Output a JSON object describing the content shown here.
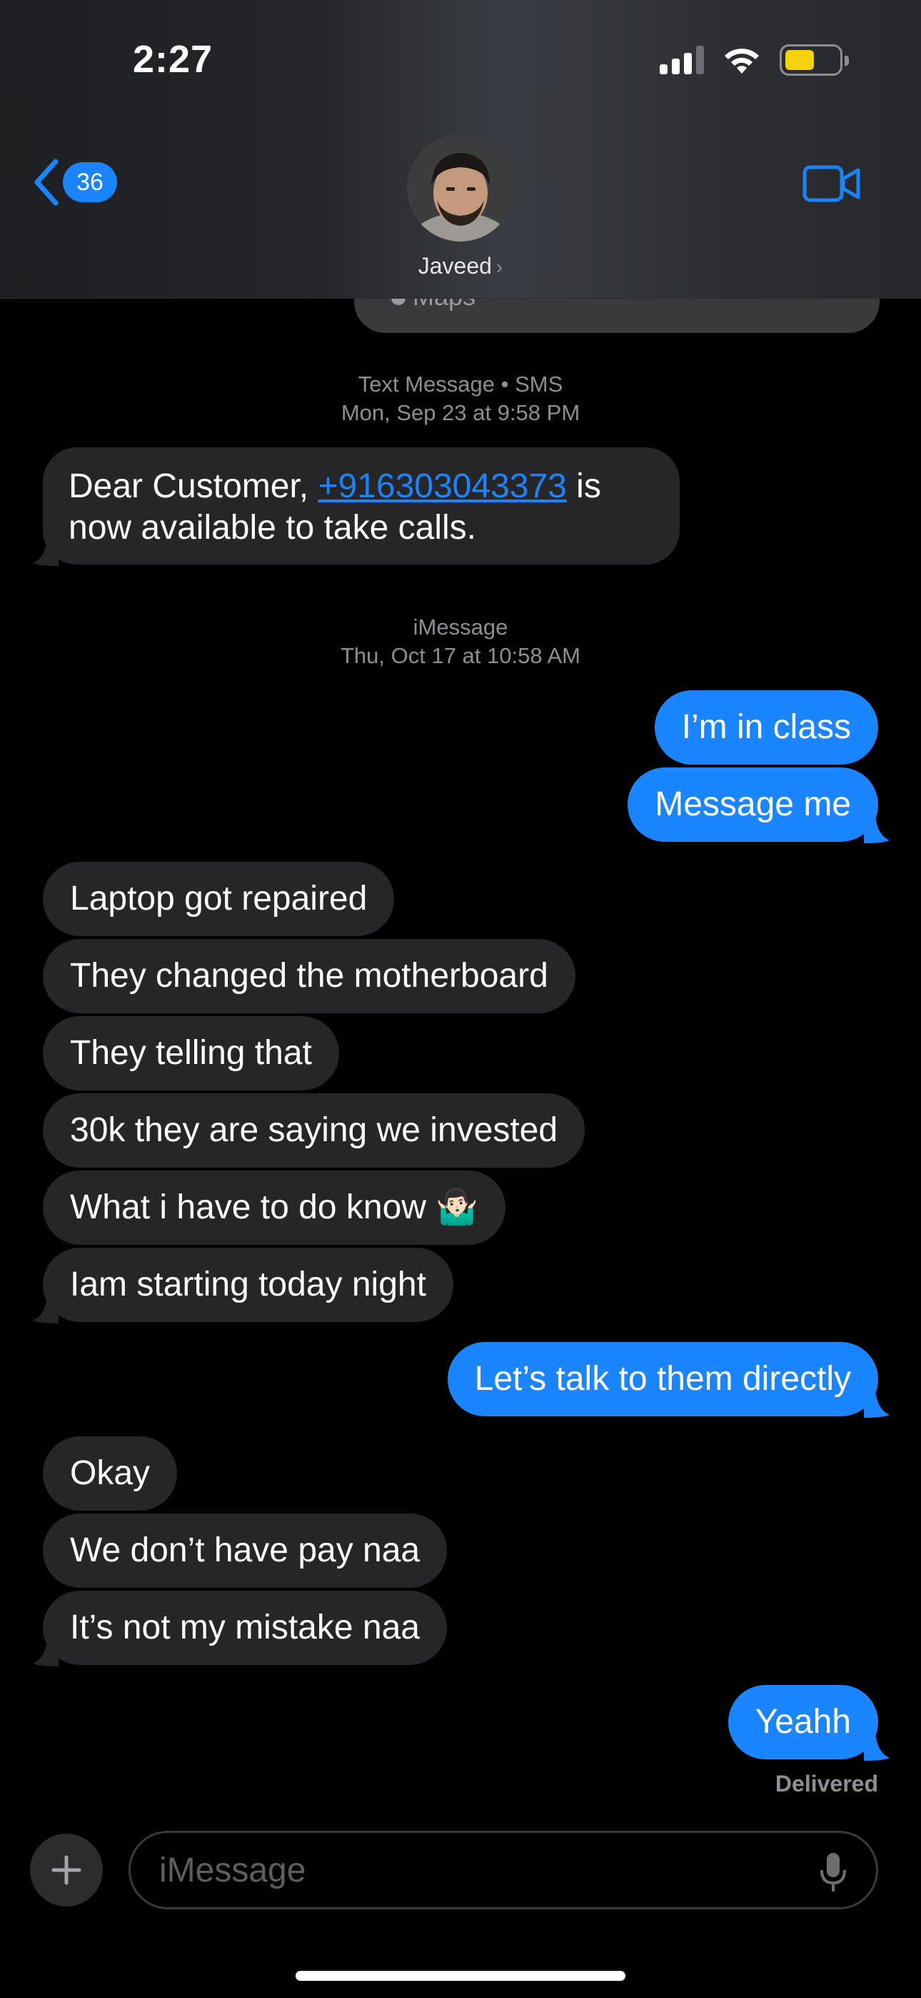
{
  "status_bar": {
    "time": "2:27"
  },
  "header": {
    "back_count": "36",
    "contact_name": "Javeed",
    "chevron": "›"
  },
  "partial_bubble": {
    "label": "Maps"
  },
  "timestamps": [
    {
      "service": "Text Message • SMS",
      "date": "Mon, Sep 23 at 9:58 PM"
    },
    {
      "service": "iMessage",
      "date": "Thu, Oct 17 at 10:58 AM"
    }
  ],
  "sms": {
    "prefix": "Dear Customer, ",
    "phone": "+916303043373",
    "suffix": " is",
    "line2": "now available to take calls."
  },
  "messages": {
    "out1": "I’m in class",
    "out2": "Message me",
    "in1": "Laptop got repaired",
    "in2": "They changed the motherboard",
    "in3": "They telling that",
    "in4": "30k they are saying we invested",
    "in5": "What i have to do know",
    "in5_emoji": "🤷🏻‍♂️",
    "in6": "Iam starting today night",
    "out3": "Let’s talk to them directly",
    "in7": "Okay",
    "in8": "We don’t have pay naa",
    "in9": "It’s not my mistake naa",
    "out4": "Yeahh"
  },
  "delivery_status": "Delivered",
  "composer": {
    "placeholder": "iMessage"
  },
  "colors": {
    "accent": "#1a84ff",
    "incoming": "#262628",
    "background": "#000000",
    "battery": "#f5d20b"
  }
}
